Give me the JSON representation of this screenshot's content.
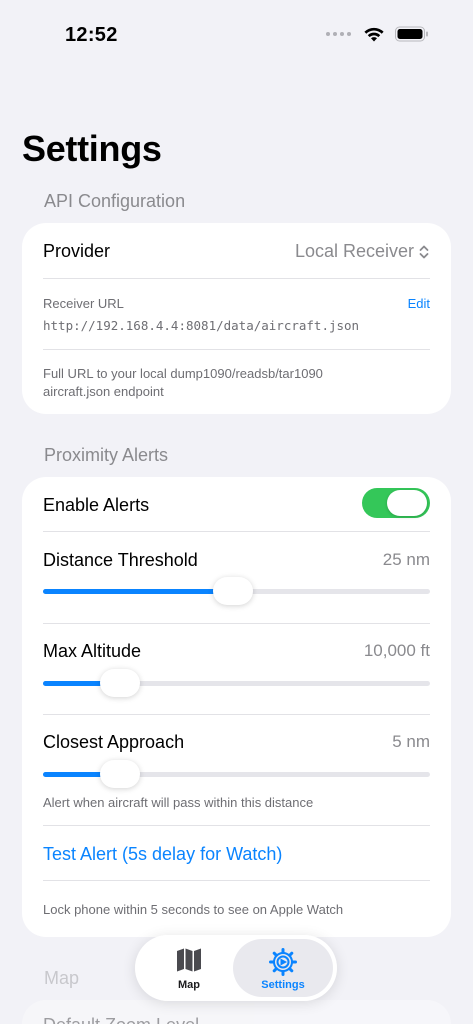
{
  "status_bar": {
    "time": "12:52"
  },
  "page_title": "Settings",
  "api_section": {
    "header": "API Configuration",
    "provider_label": "Provider",
    "provider_value": "Local Receiver",
    "receiver_url_label": "Receiver URL",
    "edit_label": "Edit",
    "receiver_url_value": "http://192.168.4.4:8081/data/aircraft.json",
    "help_text_line1": "Full URL to your local dump1090/readsb/tar1090",
    "help_text_line2": "aircraft.json endpoint"
  },
  "alerts_section": {
    "header": "Proximity Alerts",
    "enable_label": "Enable Alerts",
    "enable_on": true,
    "distance": {
      "label": "Distance Threshold",
      "value_text": "25 nm",
      "fraction": 0.49
    },
    "altitude": {
      "label": "Max Altitude",
      "value_text": "10,000 ft",
      "fraction": 0.2
    },
    "closest": {
      "label": "Closest Approach",
      "value_text": "5 nm",
      "fraction": 0.2,
      "help": "Alert when aircraft will pass within this distance"
    },
    "test_alert_label": "Test Alert (5s delay for Watch)",
    "test_alert_help": "Lock phone within 5 seconds to see on Apple Watch"
  },
  "map_section": {
    "header": "Map",
    "default_zoom_label": "Default Zoom Level"
  },
  "tabbar": {
    "tabs": [
      {
        "label": "Map",
        "icon": "map-icon",
        "selected": false
      },
      {
        "label": "Settings",
        "icon": "gear-icon",
        "selected": true
      }
    ]
  },
  "colors": {
    "accent": "#0a84ff",
    "toggle_on": "#34c759",
    "background": "#f2f2f7"
  }
}
